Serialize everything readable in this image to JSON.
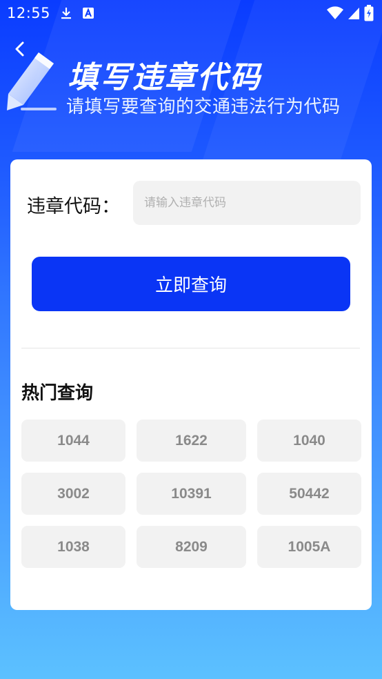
{
  "status_bar": {
    "time": "12:55",
    "icons": [
      "download-icon",
      "notification-a-icon",
      "wifi-icon",
      "signal-icon",
      "battery-icon"
    ]
  },
  "header": {
    "title": "填写违章代码",
    "subtitle": "请填写要查询的交通违法行为代码"
  },
  "form": {
    "label": "违章代码：",
    "placeholder": "请输入违章代码",
    "value": "",
    "submit_label": "立即查询"
  },
  "hot": {
    "title": "热门查询",
    "items": [
      "1044",
      "1622",
      "1040",
      "3002",
      "10391",
      "50442",
      "1038",
      "8209",
      "1005A"
    ]
  },
  "colors": {
    "primary": "#0a35f5",
    "chip_bg": "#f2f2f2",
    "chip_text": "#8a8a8a"
  }
}
